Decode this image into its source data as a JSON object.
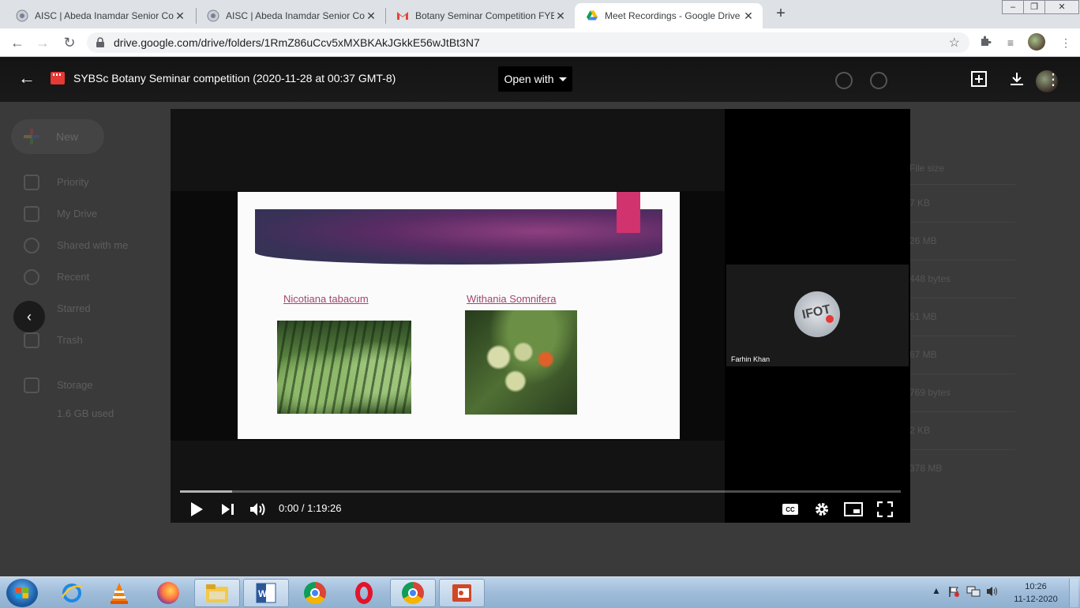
{
  "browser": {
    "tabs": [
      {
        "title": "AISC | Abeda Inamdar Senior Col",
        "close": "✕"
      },
      {
        "title": "AISC | Abeda Inamdar Senior Col",
        "close": "✕"
      },
      {
        "title": "Botany Seminar Competition FYB",
        "close": "✕"
      },
      {
        "title": "Meet Recordings - Google Drive",
        "close": "✕"
      }
    ],
    "new_tab": "+",
    "url": "drive.google.com/drive/folders/1RmZ86uCcv5xMXBKAkJGkkE56wJtBt3N7"
  },
  "drive_background": {
    "new_label": "New",
    "nav": [
      "Priority",
      "My Drive",
      "Shared with me",
      "Recent",
      "Starred",
      "Trash"
    ],
    "storage_label": "Storage",
    "storage_used": "1.6 GB used",
    "column_header": "File size",
    "sizes": [
      "7 KB",
      "26 MB",
      "448 bytes",
      "51 MB",
      "67 MB",
      "769 bytes",
      "2 KB",
      "378 MB"
    ]
  },
  "viewer": {
    "file_title": "SYBSc Botany Seminar competition (2020-11-28 at 00:37 GMT-8)",
    "open_with": "Open with"
  },
  "slide": {
    "caption_left": "Nicotiana tabacum",
    "caption_right": "Withania Somnifera"
  },
  "participant": {
    "name": "Farhin Khan",
    "avatar_text": "IFOT"
  },
  "player": {
    "time": "0:00 / 1:19:26",
    "progress": 0,
    "cc_label": "CC"
  },
  "taskbar": {
    "time": "10:26",
    "date": "11-12-2020"
  },
  "colors": {
    "accent_red": "#ff0000",
    "slide_caption": "#a3456e",
    "slide_tag": "#d0336e"
  }
}
